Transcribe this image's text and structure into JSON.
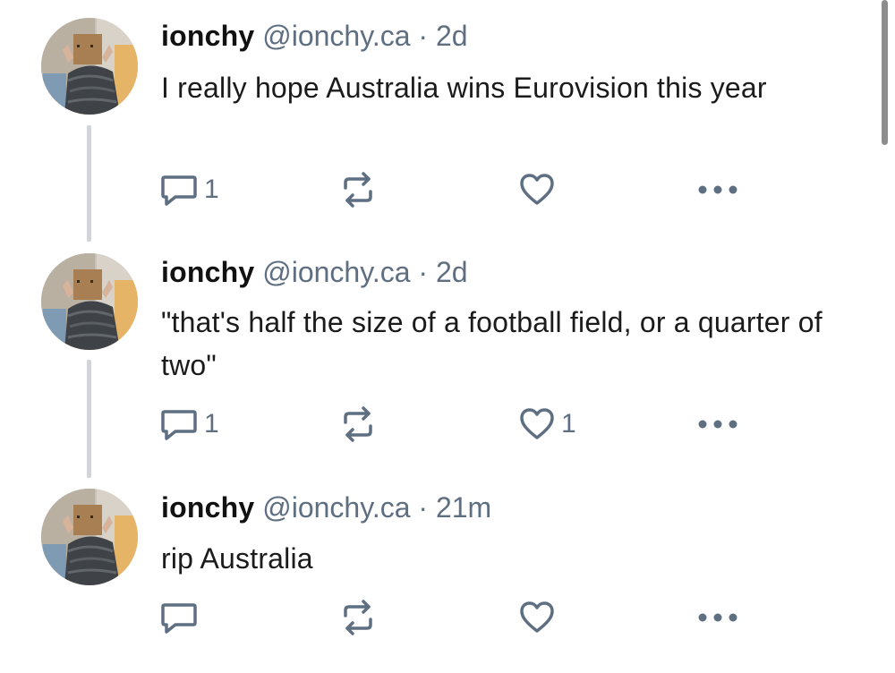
{
  "posts": [
    {
      "display_name": "ionchy",
      "handle": "@ionchy.ca",
      "separator": "·",
      "time": "2d",
      "text": "I really hope Australia wins Eurovision this year",
      "reply_count": "1",
      "repost_count": "",
      "like_count": ""
    },
    {
      "display_name": "ionchy",
      "handle": "@ionchy.ca",
      "separator": "·",
      "time": "2d",
      "text": "\"that's half the size of a football field, or a quarter of two\"",
      "reply_count": "1",
      "repost_count": "",
      "like_count": "1"
    },
    {
      "display_name": "ionchy",
      "handle": "@ionchy.ca",
      "separator": "·",
      "time": "21m",
      "text": "rip Australia",
      "reply_count": "",
      "repost_count": "",
      "like_count": ""
    }
  ],
  "icons": {
    "reply": "reply-icon",
    "repost": "repost-icon",
    "like": "heart-icon",
    "more": "more-options-icon"
  },
  "colors": {
    "meta_text": "#5f6f82",
    "icon": "#5f6f82",
    "thread_line": "#cfd5db",
    "body_text": "#1b1b1b"
  }
}
